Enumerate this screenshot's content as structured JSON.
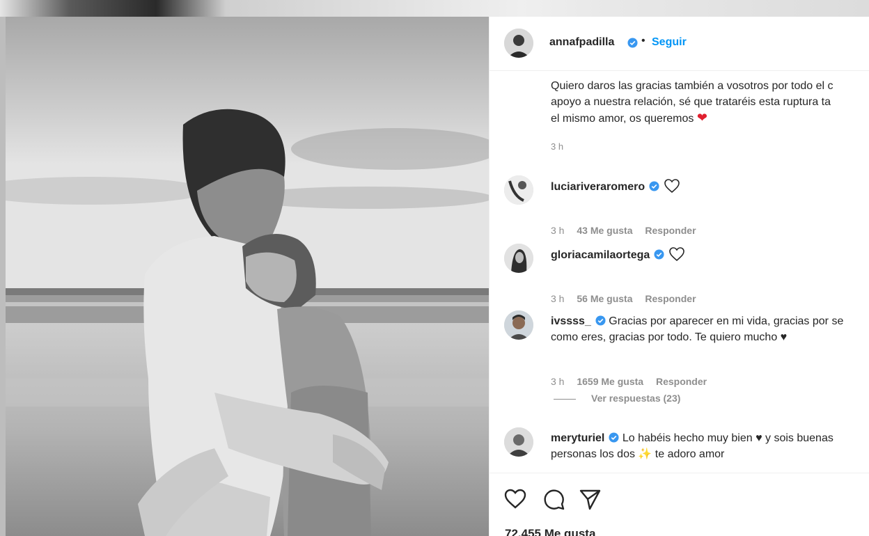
{
  "post": {
    "author": "annafpadilla",
    "separator": "•",
    "follow_label": "Seguir",
    "caption_lines": [
      "Quiero daros las gracias también a vosotros por todo el c",
      "apoyo a nuestra relación, sé que trataréis esta ruptura ta",
      "el mismo amor, os queremos"
    ],
    "caption_emoji": "❤",
    "caption_time": "3 h",
    "likes_count": "72.455 Me gusta"
  },
  "comments": [
    {
      "user": "luciariveraromero",
      "text": "",
      "time": "3 h",
      "likes": "43 Me gusta",
      "reply": "Responder"
    },
    {
      "user": "gloriacamilaortega",
      "text": "",
      "time": "3 h",
      "likes": "56 Me gusta",
      "reply": "Responder"
    },
    {
      "user": "ivssss_",
      "text": "Gracias por aparecer en mi vida, gracias por se",
      "text2": "como eres, gracias por todo. Te quiero mucho ♥",
      "time": "3 h",
      "likes": "1659 Me gusta",
      "reply": "Responder",
      "view_replies": "Ver respuestas (23)"
    },
    {
      "user": "meryturiel",
      "text": "Lo habéis hecho muy bien ♥ y sois buenas",
      "text2": "personas los dos ✨ te adoro amor"
    }
  ],
  "icons": {
    "like": "heart-outline-icon",
    "comment": "comment-bubble-icon",
    "share": "paper-plane-icon",
    "verified": "verified-badge-icon"
  },
  "colors": {
    "link": "#0095f6",
    "verified": "#3897f0",
    "muted": "#8e8e8e",
    "heart": "#e0202f"
  }
}
